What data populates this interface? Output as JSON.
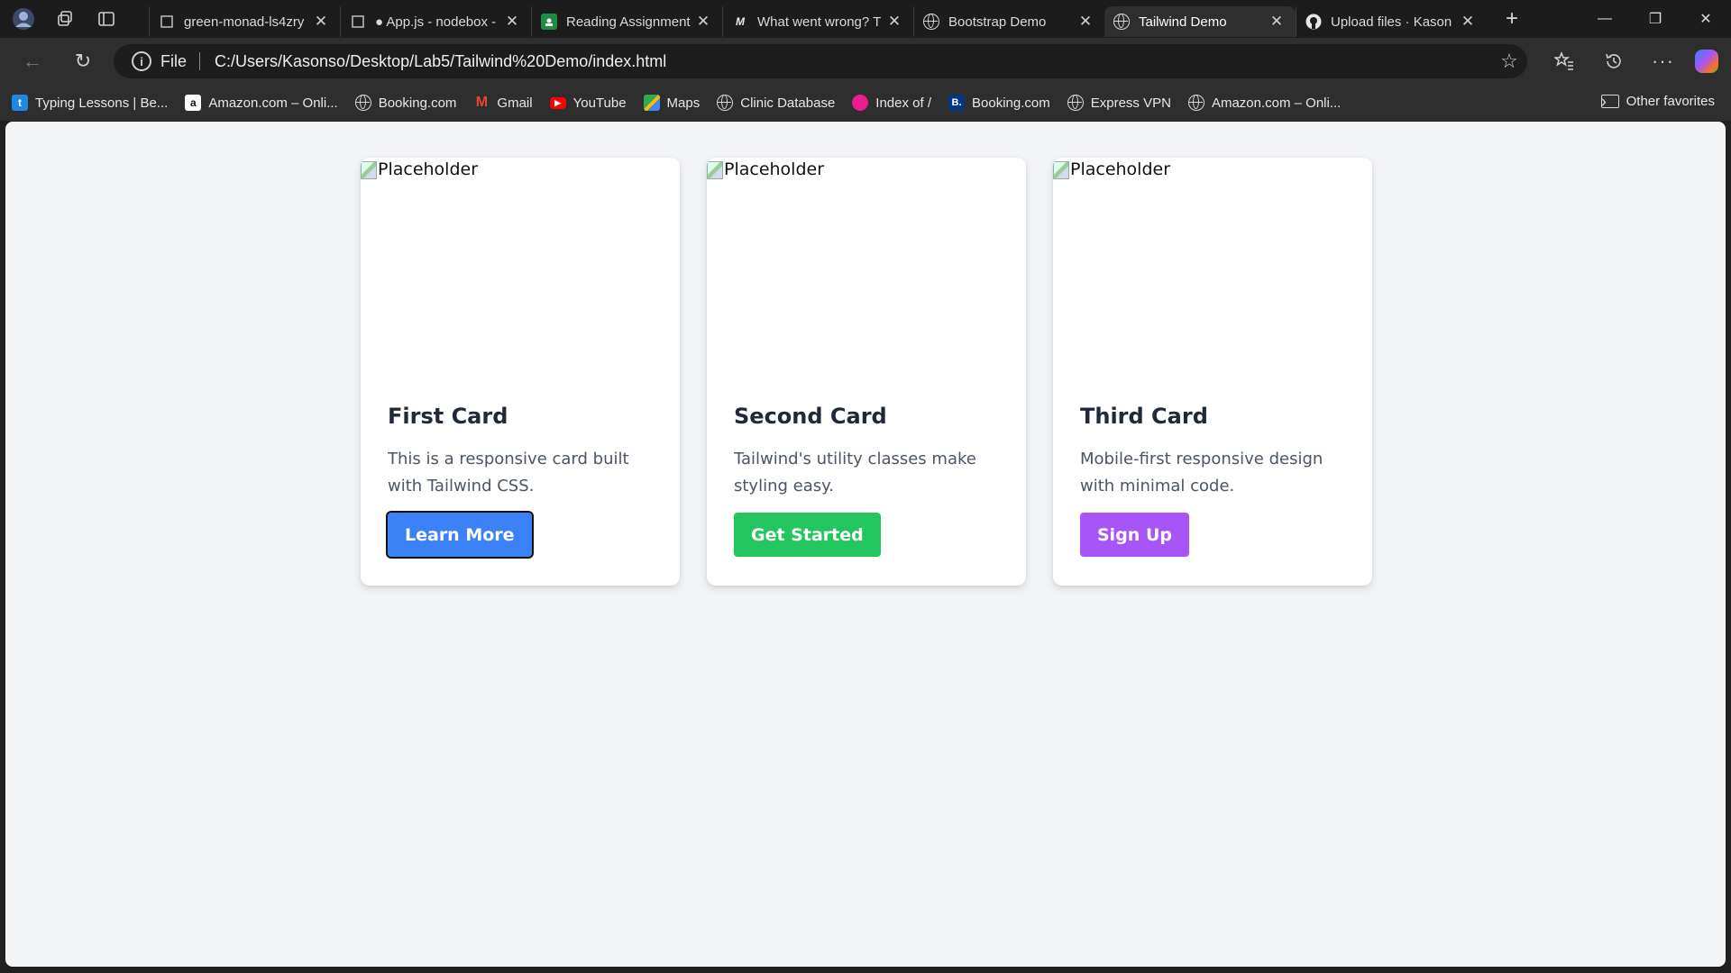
{
  "tabs": [
    {
      "title": "green-monad-ls4zry",
      "favicon": "codesandbox-icon",
      "active": false
    },
    {
      "title": "● App.js - nodebox -",
      "favicon": "codesandbox-icon",
      "active": false
    },
    {
      "title": "Reading Assignment",
      "favicon": "google-classroom-icon",
      "active": false
    },
    {
      "title": "What went wrong? T",
      "favicon": "medium-icon",
      "active": false
    },
    {
      "title": "Bootstrap Demo",
      "favicon": "globe-icon",
      "active": false
    },
    {
      "title": "Tailwind Demo",
      "favicon": "globe-icon",
      "active": true
    },
    {
      "title": "Upload files · Kason",
      "favicon": "github-icon",
      "active": false
    }
  ],
  "address": {
    "scheme": "File",
    "url": "C:/Users/Kasonso/Desktop/Lab5/Tailwind%20Demo/index.html"
  },
  "favorites": [
    {
      "label": "Typing Lessons | Be...",
      "icon": "typing-icon",
      "color": "#1e88e5"
    },
    {
      "label": "Amazon.com – Onli...",
      "icon": "amazon-icon",
      "color": "#ffffff"
    },
    {
      "label": "Booking.com",
      "icon": "globe-icon",
      "color": "#d8d8d8"
    },
    {
      "label": "Gmail",
      "icon": "gmail-icon",
      "color": "#ea4335"
    },
    {
      "label": "YouTube",
      "icon": "youtube-icon",
      "color": "#ff0000"
    },
    {
      "label": "Maps",
      "icon": "maps-icon",
      "color": "#34a853"
    },
    {
      "label": "Clinic Database",
      "icon": "globe-icon",
      "color": "#d8d8d8"
    },
    {
      "label": "Index of /",
      "icon": "index-icon",
      "color": "#e91e8c"
    },
    {
      "label": "Booking.com",
      "icon": "booking-icon",
      "color": "#003580"
    },
    {
      "label": "Express VPN",
      "icon": "globe-icon",
      "color": "#d8d8d8"
    },
    {
      "label": "Amazon.com – Onli...",
      "icon": "globe-icon",
      "color": "#d8d8d8"
    }
  ],
  "other_favorites": "Other favorites",
  "cards": [
    {
      "img_alt": "Placeholder",
      "title": "First Card",
      "text": "This is a responsive card built with Tailwind CSS.",
      "button": "Learn More",
      "button_color": "#3b82f6"
    },
    {
      "img_alt": "Placeholder",
      "title": "Second Card",
      "text": "Tailwind's utility classes make styling easy.",
      "button": "Get Started",
      "button_color": "#22c55e"
    },
    {
      "img_alt": "Placeholder",
      "title": "Third Card",
      "text": "Mobile-first responsive design with minimal code.",
      "button": "Sign Up",
      "button_color": "#a855f7"
    }
  ]
}
